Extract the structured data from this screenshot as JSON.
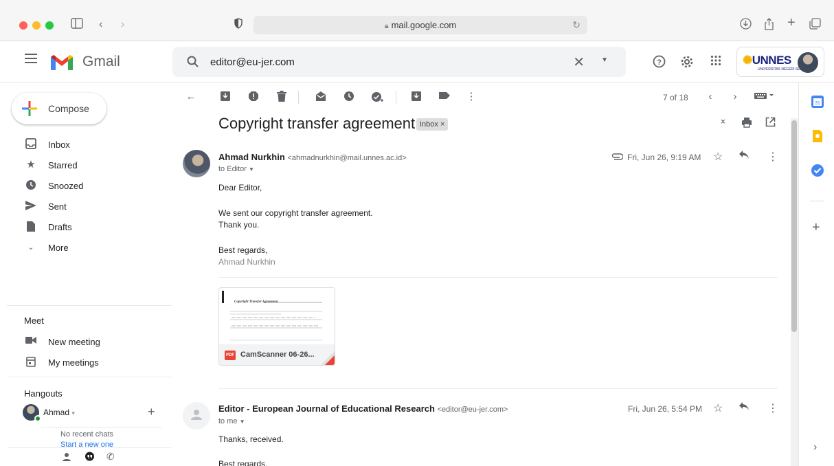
{
  "browser": {
    "url": "mail.google.com"
  },
  "gmail": {
    "app_name": "Gmail",
    "search_query": "editor@eu-jer.com",
    "account_brand": "UNNES",
    "account_sub": "UNIVERSITAS NEGERI SEMARANG"
  },
  "nav": {
    "compose": "Compose",
    "items": [
      {
        "label": "Inbox",
        "icon": "inbox-icon"
      },
      {
        "label": "Starred",
        "icon": "star-icon"
      },
      {
        "label": "Snoozed",
        "icon": "clock-icon"
      },
      {
        "label": "Sent",
        "icon": "send-icon"
      },
      {
        "label": "Drafts",
        "icon": "draft-icon"
      },
      {
        "label": "More",
        "icon": "chevron-down-icon"
      }
    ],
    "meet_title": "Meet",
    "meet_items": [
      {
        "label": "New meeting",
        "icon": "video-icon"
      },
      {
        "label": "My meetings",
        "icon": "calendar-icon"
      }
    ],
    "hangouts_title": "Hangouts",
    "hangouts_user": "Ahmad",
    "no_chats": "No recent chats",
    "start_new": "Start a new one"
  },
  "toolbar": {
    "pager": "7 of 18"
  },
  "thread": {
    "subject": "Copyright transfer agreement",
    "label": "Inbox",
    "messages": [
      {
        "sender_name": "Ahmad Nurkhin",
        "sender_email": "<ahmadnurkhin@mail.unnes.ac.id>",
        "to": "to Editor",
        "date": "Fri, Jun 26, 9:19 AM",
        "lines": [
          "Dear Editor,",
          "We sent our copyright transfer agreement.",
          "Thank you.",
          "Best regards,",
          "Ahmad Nurkhin"
        ],
        "attachment": "CamScanner 06-26...",
        "attachment_doc_title": "Copyright Transfer Agreement"
      },
      {
        "sender_name": "Editor - European Journal of Educational Research",
        "sender_email": "<editor@eu-jer.com>",
        "to": "to me",
        "date": "Fri, Jun 26, 5:54 PM",
        "lines": [
          "Thanks, received.",
          "Best regards,"
        ]
      }
    ]
  },
  "colors": {
    "gmail_red": "#ea4335",
    "accent_blue": "#1a73e8"
  }
}
